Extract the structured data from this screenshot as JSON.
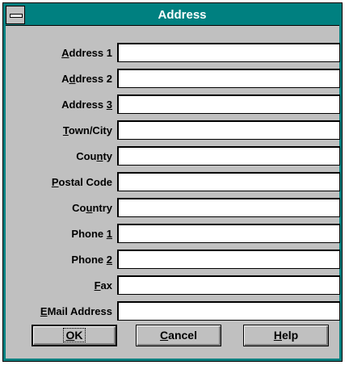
{
  "window": {
    "title": "Address"
  },
  "fields": [
    {
      "id": "address1",
      "pre": "",
      "ul": "A",
      "post": "ddress 1",
      "value": ""
    },
    {
      "id": "address2",
      "pre": "A",
      "ul": "d",
      "post": "dress 2",
      "value": ""
    },
    {
      "id": "address3",
      "pre": "Address ",
      "ul": "3",
      "post": "",
      "value": ""
    },
    {
      "id": "town",
      "pre": "",
      "ul": "T",
      "post": "own/City",
      "value": ""
    },
    {
      "id": "county",
      "pre": "Cou",
      "ul": "n",
      "post": "ty",
      "value": ""
    },
    {
      "id": "postal",
      "pre": "",
      "ul": "P",
      "post": "ostal Code",
      "value": ""
    },
    {
      "id": "country",
      "pre": "Co",
      "ul": "u",
      "post": "ntry",
      "value": ""
    },
    {
      "id": "phone1",
      "pre": "Phone ",
      "ul": "1",
      "post": "",
      "value": ""
    },
    {
      "id": "phone2",
      "pre": "Phone ",
      "ul": "2",
      "post": "",
      "value": ""
    },
    {
      "id": "fax",
      "pre": "",
      "ul": "F",
      "post": "ax",
      "value": ""
    },
    {
      "id": "email",
      "pre": "",
      "ul": "E",
      "post": "Mail Address",
      "value": ""
    }
  ],
  "buttons": {
    "ok": {
      "ul": "O",
      "post": "K"
    },
    "cancel": {
      "ul": "C",
      "post": "ancel"
    },
    "help": {
      "ul": "H",
      "post": "elp"
    }
  },
  "colors": {
    "titlebar": "#008080",
    "face": "#c0c0c0"
  }
}
